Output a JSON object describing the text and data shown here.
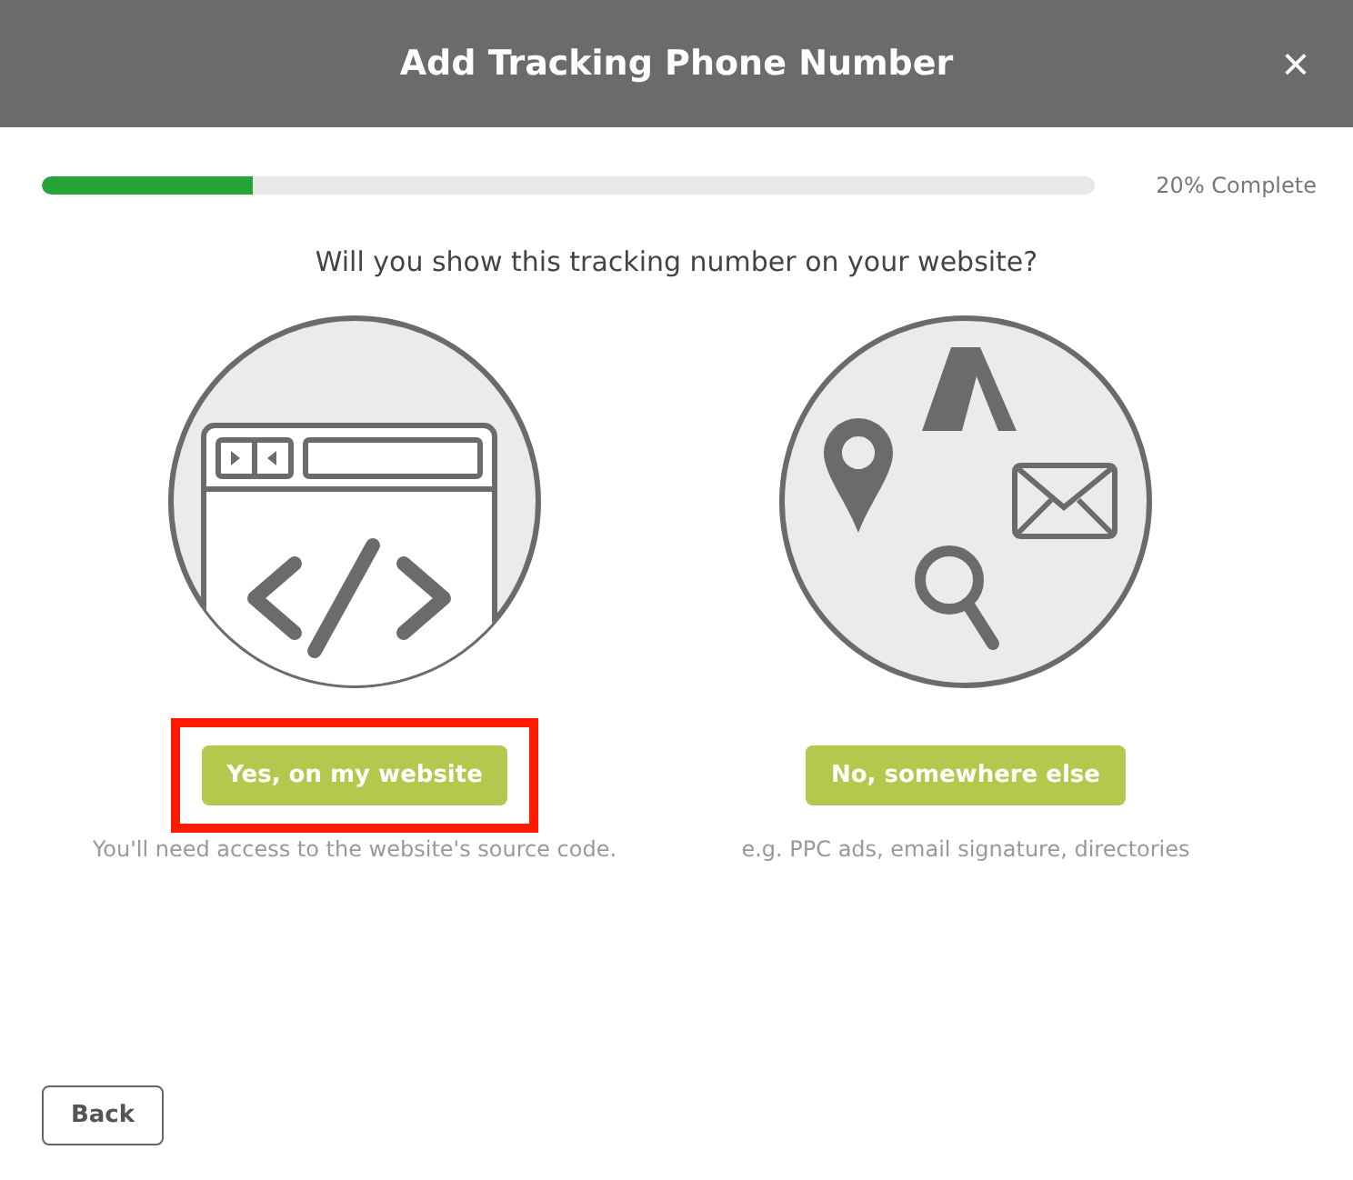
{
  "dialog": {
    "title": "Add Tracking Phone Number",
    "close": "×"
  },
  "progress": {
    "level": 0.2,
    "label": "20% Complete"
  },
  "question": "Will you show this tracking number on your website?",
  "options": [
    {
      "kind": "website",
      "button": "Yes, on my website",
      "caption": "You'll need access to the website's source code.",
      "highlighted": true
    },
    {
      "kind": "elsewhere",
      "button": "No, somewhere else",
      "caption": "e.g. PPC ads, email signature, directories",
      "highlighted": false
    }
  ],
  "back": "Back"
}
